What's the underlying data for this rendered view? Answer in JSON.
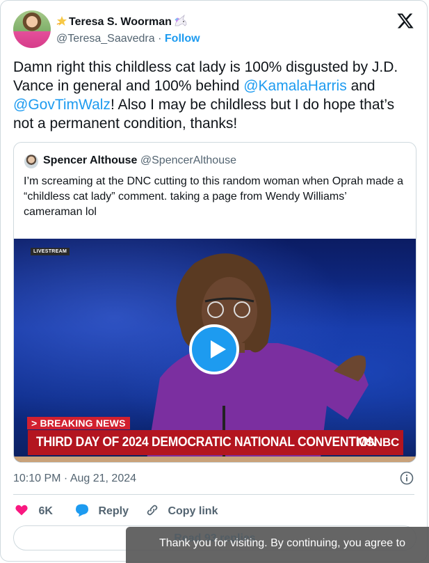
{
  "author": {
    "name": "Teresa S. Woorman",
    "handle": "@Teresa_Saavedra",
    "separator": "·",
    "follow_label": "Follow",
    "star_emoji": "star-emoji",
    "unicorn_emoji": "unicorn-emoji"
  },
  "tweet": {
    "parts": [
      "Damn right this childless cat lady is 100% disgusted by J.D. Vance in general and 100% behind ",
      "@KamalaHarris",
      " and ",
      "@GovTimWalz",
      "! Also I may be childless but I do hope that’s not a permanent condition, thanks!"
    ]
  },
  "quote": {
    "name": "Spencer Althouse",
    "handle": "@SpencerAlthouse",
    "text": "I’m screaming at the DNC cutting to this random woman when Oprah made a “childless cat lady” comment. taking a page from Wendy Williams’ cameraman lol",
    "video": {
      "livestream_label": "LIVESTREAM",
      "breaking_label": "> BREAKING NEWS",
      "lower_third": "THIRD DAY OF 2024 DEMOCRATIC NATIONAL CONVENTION",
      "network": "MSNBC"
    }
  },
  "meta": {
    "timestamp": "10:10 PM · Aug 21, 2024"
  },
  "actions": {
    "likes": "6K",
    "reply_label": "Reply",
    "copy_link_label": "Copy link",
    "read_replies_label": "Read 93 replies"
  },
  "cookie_banner": {
    "text": "Thank you for visiting. By continuing, you agree to"
  },
  "colors": {
    "accent": "#1d9bf0",
    "like": "#f91880",
    "muted": "#536471",
    "border": "#cfd9de"
  }
}
